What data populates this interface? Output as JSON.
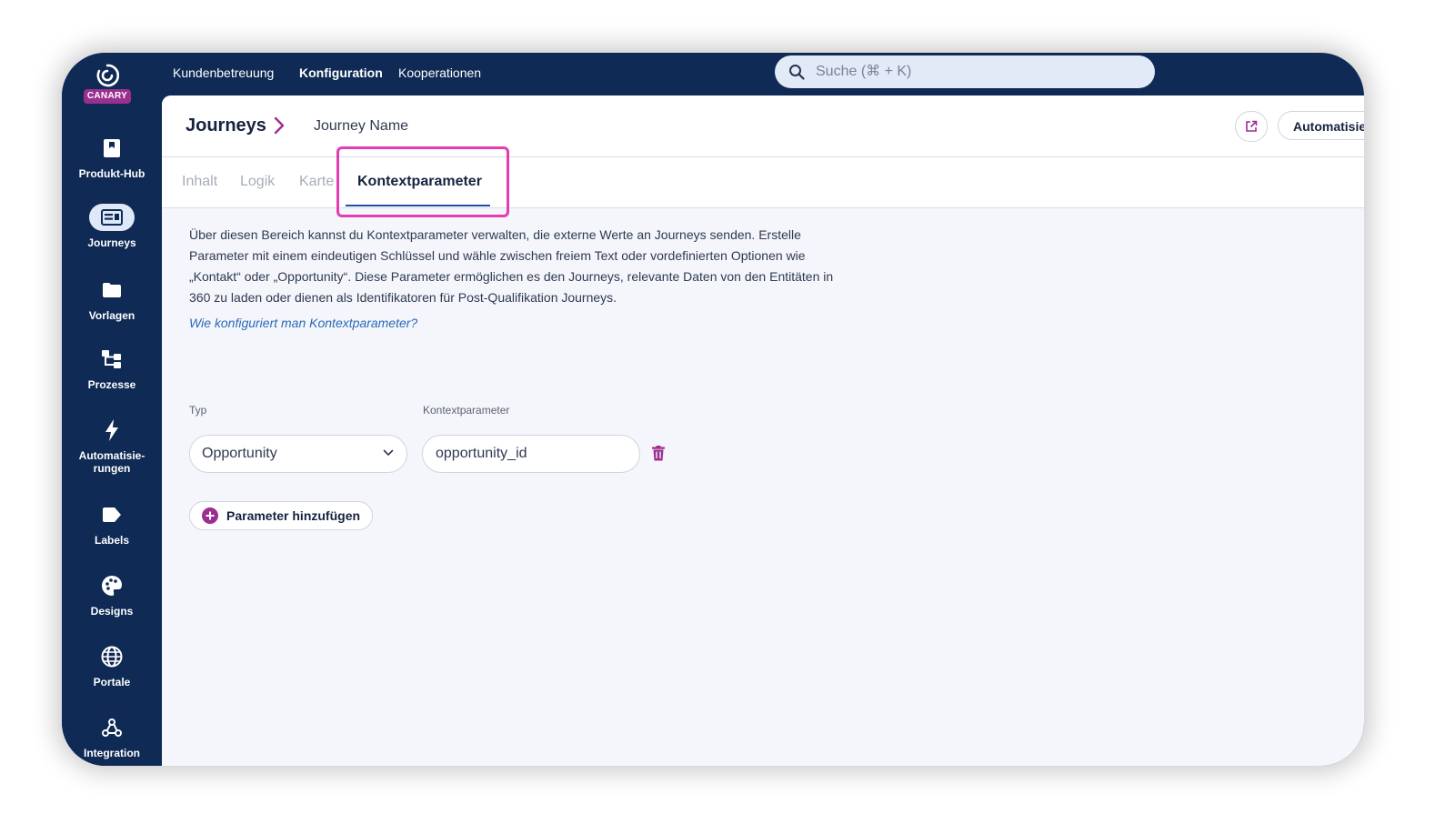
{
  "app": {
    "logo_text": "CANARY"
  },
  "sidebar": {
    "items": [
      {
        "label": "Produkt-Hub",
        "icon": "bookmark-icon"
      },
      {
        "label": "Journeys",
        "icon": "journey-icon",
        "active": true
      },
      {
        "label": "Vorlagen",
        "icon": "folder-icon"
      },
      {
        "label": "Prozesse",
        "icon": "process-icon"
      },
      {
        "label": "Automatisie-rungen",
        "line1": "Automatisie-",
        "line2": "rungen",
        "icon": "lightning-icon"
      },
      {
        "label": "Labels",
        "icon": "label-icon"
      },
      {
        "label": "Designs",
        "icon": "palette-icon"
      },
      {
        "label": "Portale",
        "icon": "globe-icon"
      },
      {
        "label": "Integration",
        "icon": "webhook-icon"
      }
    ]
  },
  "topbar": {
    "links": [
      "Kundenbetreuung",
      "Konfiguration",
      "Kooperationen"
    ],
    "active_link": "Konfiguration",
    "search_placeholder": "Suche (⌘ + K)"
  },
  "header": {
    "breadcrumb_root": "Journeys",
    "breadcrumb_current": "Journey Name",
    "automation_button": "Automatisier"
  },
  "tabs": {
    "items": [
      "Inhalt",
      "Logik",
      "Karte",
      "Kontextparameter"
    ],
    "active": "Kontextparameter"
  },
  "content": {
    "description": "Über diesen Bereich kannst du Kontextparameter verwalten, die externe Werte an Journeys senden. Erstelle Parameter mit einem eindeutigen Schlüssel und wähle zwischen freiem Text oder vordefinierten Optionen wie „Kontakt“ oder „Opportunity“. Diese Parameter ermöglichen es den Journeys, relevante Daten von den Entitäten in 360 zu laden oder dienen als Identifikatoren für Post-Qualifikation Journeys.",
    "help_link": "Wie konfiguriert man Kontextparameter?",
    "type_label": "Typ",
    "param_label": "Kontextparameter",
    "type_value": "Opportunity",
    "param_value": "opportunity_id",
    "add_button": "Parameter hinzufügen"
  },
  "colors": {
    "navy": "#0e2a55",
    "accent": "#9b2f8f",
    "highlight": "#e33cb4",
    "link": "#2a6ab8"
  }
}
